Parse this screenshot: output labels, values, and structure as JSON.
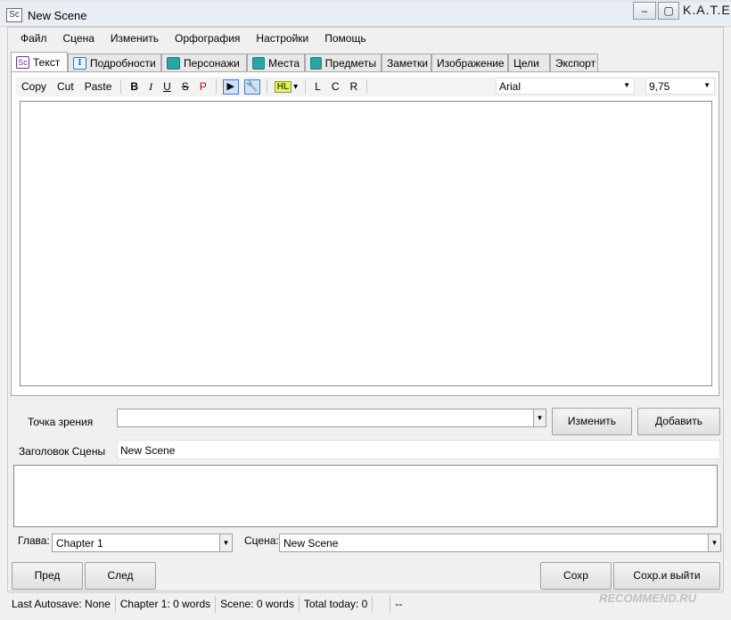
{
  "window": {
    "title": "New Scene",
    "icon": "Sc",
    "brand": "K.A.T.E."
  },
  "window_controls": [
    "minimize",
    "maximize",
    "close"
  ],
  "menu": [
    "Файл",
    "Сцена",
    "Изменить",
    "Орфография",
    "Настройки",
    "Помощь"
  ],
  "tabs": [
    {
      "label": "Текст",
      "icon": "sc-icon"
    },
    {
      "label": "Подробности",
      "icon": "text-cursor-icon"
    },
    {
      "label": "Персонажи",
      "icon": "person-icon"
    },
    {
      "label": "Места",
      "icon": "building-icon"
    },
    {
      "label": "Предметы",
      "icon": "wand-icon"
    },
    {
      "label": "Заметки",
      "icon": ""
    },
    {
      "label": "Изображение",
      "icon": ""
    },
    {
      "label": "Цели",
      "icon": ""
    },
    {
      "label": "Экспорт",
      "icon": ""
    }
  ],
  "toolbar": {
    "copy": "Copy",
    "cut": "Cut",
    "paste": "Paste",
    "bold": "B",
    "italic": "I",
    "underline": "U",
    "strike": "S",
    "p": "P",
    "play": "▶",
    "pin": "🔧",
    "hl": "HL",
    "left": "L",
    "center": "C",
    "right": "R",
    "font": "Arial",
    "size": "9,75"
  },
  "pov": {
    "label": "Точка зрения",
    "value": "",
    "change": "Изменить",
    "add": "Добавить"
  },
  "scene_title": {
    "label": "Заголовок Сцены",
    "value": "New Scene"
  },
  "chapter": {
    "label": "Глава:",
    "value": "Chapter 1"
  },
  "scene": {
    "label": "Сцена:",
    "value": "New Scene"
  },
  "buttons": {
    "prev": "Пред",
    "next": "След",
    "save": "Сохр",
    "save_exit": "Сохр.и выйти"
  },
  "status": {
    "autosave": "Last Autosave: None",
    "chapter_words": "Chapter 1: 0 words",
    "scene_words": "Scene: 0 words",
    "total": "Total today: 0",
    "extra": "--"
  },
  "watermark": "RECOMMEND.RU"
}
